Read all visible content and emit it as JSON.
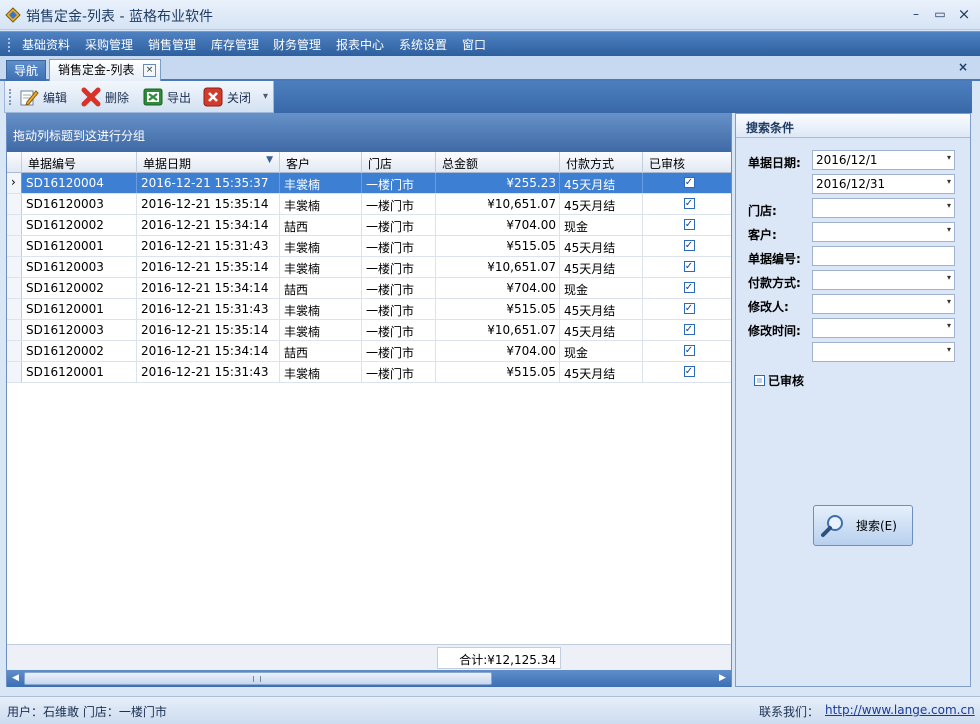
{
  "window": {
    "title": "销售定金-列表 - 蓝格布业软件",
    "minimize": "–",
    "maximize": "▭",
    "close": "×"
  },
  "menu": [
    "基础资料",
    "采购管理",
    "销售管理",
    "库存管理",
    "财务管理",
    "报表中心",
    "系统设置",
    "窗口"
  ],
  "tabs": {
    "nav": "导航",
    "doc": "销售定金-列表",
    "doc_close": "×",
    "strip_close": "×"
  },
  "toolbar": {
    "edit": "编辑",
    "delete": "删除",
    "export": "导出",
    "close": "关闭",
    "more": "▾"
  },
  "grid": {
    "group_hint": "拖动列标题到这进行分组",
    "columns": [
      "单据编号",
      "单据日期",
      "客户",
      "门店",
      "总金额",
      "付款方式",
      "已审核"
    ],
    "sort_indicator": "▼",
    "rows": [
      {
        "ind": "›",
        "no": "SD16120004",
        "date": "2016-12-21 15:35:37",
        "customer": "丰裳楠",
        "store": "一楼门市",
        "amount": "¥255.23",
        "pay": "45天月结",
        "audited": "✓"
      },
      {
        "ind": "",
        "no": "SD16120003",
        "date": "2016-12-21 15:35:14",
        "customer": "丰裳楠",
        "store": "一楼门市",
        "amount": "¥10,651.07",
        "pay": "45天月结",
        "audited": "✓"
      },
      {
        "ind": "",
        "no": "SD16120002",
        "date": "2016-12-21 15:34:14",
        "customer": "喆西",
        "store": "一楼门市",
        "amount": "¥704.00",
        "pay": "现金",
        "audited": "✓"
      },
      {
        "ind": "",
        "no": "SD16120001",
        "date": "2016-12-21 15:31:43",
        "customer": "丰裳楠",
        "store": "一楼门市",
        "amount": "¥515.05",
        "pay": "45天月结",
        "audited": "✓"
      },
      {
        "ind": "",
        "no": "SD16120003",
        "date": "2016-12-21 15:35:14",
        "customer": "丰裳楠",
        "store": "一楼门市",
        "amount": "¥10,651.07",
        "pay": "45天月结",
        "audited": "✓"
      },
      {
        "ind": "",
        "no": "SD16120002",
        "date": "2016-12-21 15:34:14",
        "customer": "喆西",
        "store": "一楼门市",
        "amount": "¥704.00",
        "pay": "现金",
        "audited": "✓"
      },
      {
        "ind": "",
        "no": "SD16120001",
        "date": "2016-12-21 15:31:43",
        "customer": "丰裳楠",
        "store": "一楼门市",
        "amount": "¥515.05",
        "pay": "45天月结",
        "audited": "✓"
      },
      {
        "ind": "",
        "no": "SD16120003",
        "date": "2016-12-21 15:35:14",
        "customer": "丰裳楠",
        "store": "一楼门市",
        "amount": "¥10,651.07",
        "pay": "45天月结",
        "audited": "✓"
      },
      {
        "ind": "",
        "no": "SD16120002",
        "date": "2016-12-21 15:34:14",
        "customer": "喆西",
        "store": "一楼门市",
        "amount": "¥704.00",
        "pay": "现金",
        "audited": "✓"
      },
      {
        "ind": "",
        "no": "SD16120001",
        "date": "2016-12-21 15:31:43",
        "customer": "丰裳楠",
        "store": "一楼门市",
        "amount": "¥515.05",
        "pay": "45天月结",
        "audited": "✓"
      }
    ],
    "total": "合计:¥12,125.34",
    "scroll_left": "◀",
    "scroll_right": "▶"
  },
  "search": {
    "title": "搜索条件",
    "date_label": "单据日期:",
    "date_from": "2016/12/1",
    "date_to": "2016/12/31",
    "store_label": "门店:",
    "store": "",
    "customer_label": "客户:",
    "customer": "",
    "no_label": "单据编号:",
    "no": "",
    "pay_label": "付款方式:",
    "pay": "",
    "modifier_label": "修改人:",
    "modifier": "",
    "modtime_label": "修改时间:",
    "modtime_from": "",
    "modtime_to": "",
    "audited_label": "已审核",
    "dropdown": "▾",
    "button": "搜索(E)"
  },
  "status": {
    "user": "用户：石维敢  门店：一楼门市",
    "contact_label": "联系我们：",
    "contact_url": "http://www.lange.com.cn"
  },
  "colors": {
    "selection": "#3c7fd3",
    "menubar": "#2e5f9f",
    "window_bg": "#d9e6f6"
  }
}
